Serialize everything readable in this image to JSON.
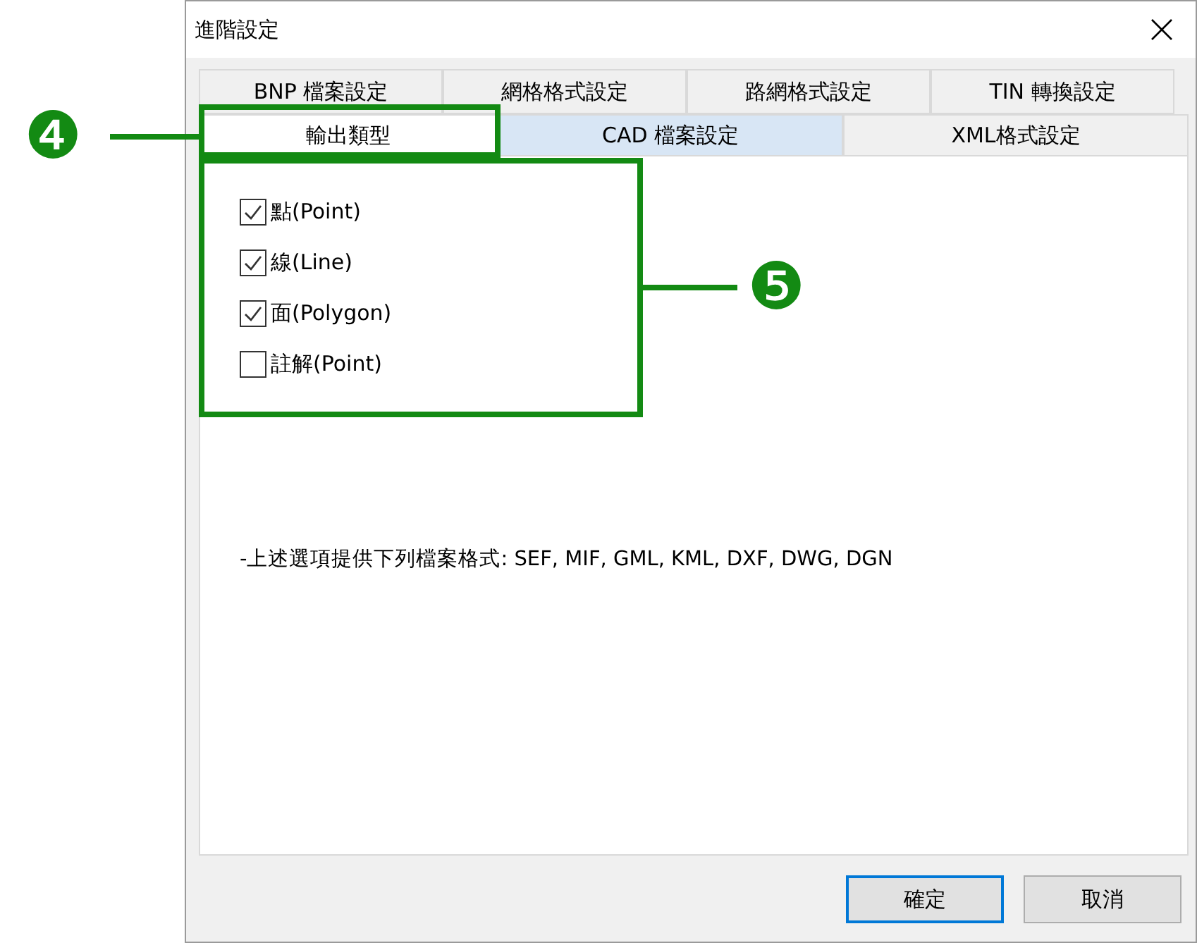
{
  "window": {
    "title": "進階設定"
  },
  "tab_rows": [
    {
      "tabs": [
        {
          "label": "BNP 檔案設定",
          "selected": false,
          "hovered": false
        },
        {
          "label": "網格格式設定",
          "selected": false,
          "hovered": false
        },
        {
          "label": "路網格式設定",
          "selected": false,
          "hovered": false
        },
        {
          "label": "TIN 轉換設定",
          "selected": false,
          "hovered": false
        }
      ]
    },
    {
      "tabs": [
        {
          "label": "輸出類型",
          "selected": true,
          "hovered": false
        },
        {
          "label": "CAD 檔案設定",
          "selected": false,
          "hovered": true
        },
        {
          "label": "XML格式設定",
          "selected": false,
          "hovered": false
        }
      ]
    }
  ],
  "options": [
    {
      "label": "點(Point)",
      "checked": true
    },
    {
      "label": "線(Line)",
      "checked": true
    },
    {
      "label": "面(Polygon)",
      "checked": true
    },
    {
      "label": "註解(Point)",
      "checked": false
    }
  ],
  "note": "-上述選項提供下列檔案格式: SEF, MIF, GML, KML, DXF, DWG, DGN",
  "buttons": [
    {
      "label": "確定",
      "default": true
    },
    {
      "label": "取消",
      "default": false
    }
  ],
  "callouts": [
    {
      "label": "❹"
    },
    {
      "label": "❺"
    }
  ]
}
